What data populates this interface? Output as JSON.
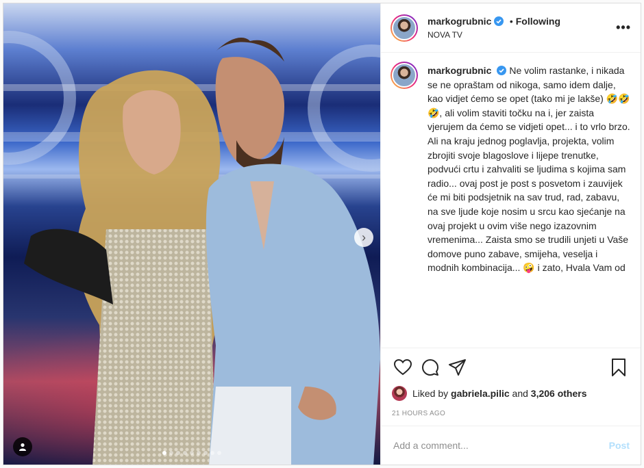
{
  "header": {
    "username": "markogrubnic",
    "following": "Following",
    "separator": "•",
    "location": "NOVA TV",
    "more": "•••"
  },
  "caption": {
    "username": "markogrubnic",
    "text": "Ne volim rastanke, i nikada se ne opraštam od nikoga, samo idem dalje, kao vidjet ćemo se opet (tako mi je lakše) 🤣🤣🤣, ali volim staviti točku na i, jer zaista vjerujem da ćemo se vidjeti opet... i to vrlo brzo. Ali na kraju jednog poglavlja, projekta, volim zbrojiti svoje blagoslove i lijepe trenutke, podvući crtu i zahvaliti se ljudima s kojima sam radio... ovaj post je post s posvetom i zauvijek će mi biti podsjetnik na sav trud, rad, zabavu, na sve ljude koje nosim u srcu kao sjećanje na ovaj projekt u ovim više nego izazovnim vremenima... Zaista smo se trudili unjeti u Vaše domove puno zabave, smijeha, veselja i modnih kombinacija... 🤪 i zato, Hvala Vam od"
  },
  "likes": {
    "prefix": "Liked by",
    "user": "gabriela.pilic",
    "and": "and",
    "others": "3,206 others"
  },
  "timestamp": "21 HOURS AGO",
  "comment": {
    "placeholder": "Add a comment...",
    "post_label": "Post"
  },
  "carousel": {
    "next_arrow": "›",
    "dot_count": 9,
    "active_index": 0
  },
  "colors": {
    "verified": "#3897f0",
    "post_button_disabled": "#b2dffc",
    "timestamp": "#8e8e8e"
  }
}
